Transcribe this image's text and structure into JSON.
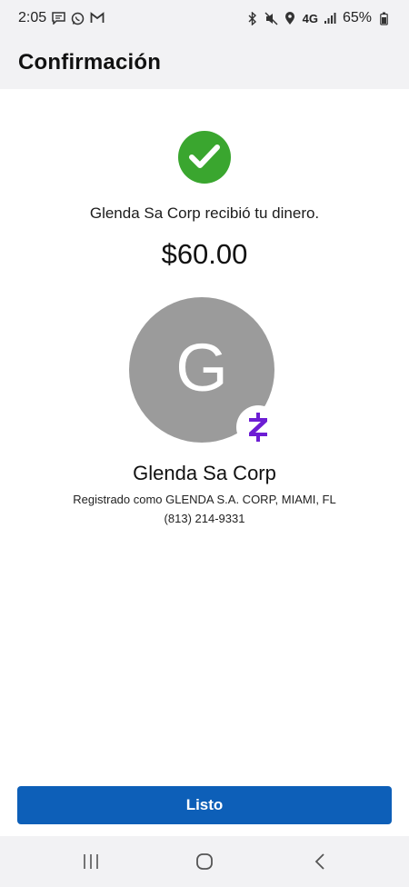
{
  "status_bar": {
    "time": "2:05",
    "battery": "65%",
    "network": "4G",
    "left_icons": [
      "message-icon",
      "whatsapp-icon",
      "gmail-icon"
    ],
    "right_icons": [
      "bluetooth-icon",
      "mute-icon",
      "location-icon",
      "network-4g-icon",
      "signal-icon",
      "battery-icon"
    ]
  },
  "header": {
    "title": "Confirmación"
  },
  "confirmation": {
    "message": "Glenda Sa Corp recibió tu dinero.",
    "amount": "$60.00",
    "success_icon": "check-circle-icon"
  },
  "recipient": {
    "initial": "G",
    "name": "Glenda Sa Corp",
    "registered_as": "Registrado como GLENDA S.A. CORP, MIAMI, FL",
    "phone": "(813) 214-9331",
    "badge_icon": "zelle-icon"
  },
  "actions": {
    "done_label": "Listo"
  },
  "nav_bar": {
    "icons": [
      "recent-apps-icon",
      "home-icon",
      "back-icon"
    ]
  },
  "colors": {
    "success": "#3aa62f",
    "primary_button": "#0d5fb8",
    "zelle": "#6d1ed4",
    "avatar": "#9b9b9b",
    "header_bg": "#f2f2f4"
  }
}
